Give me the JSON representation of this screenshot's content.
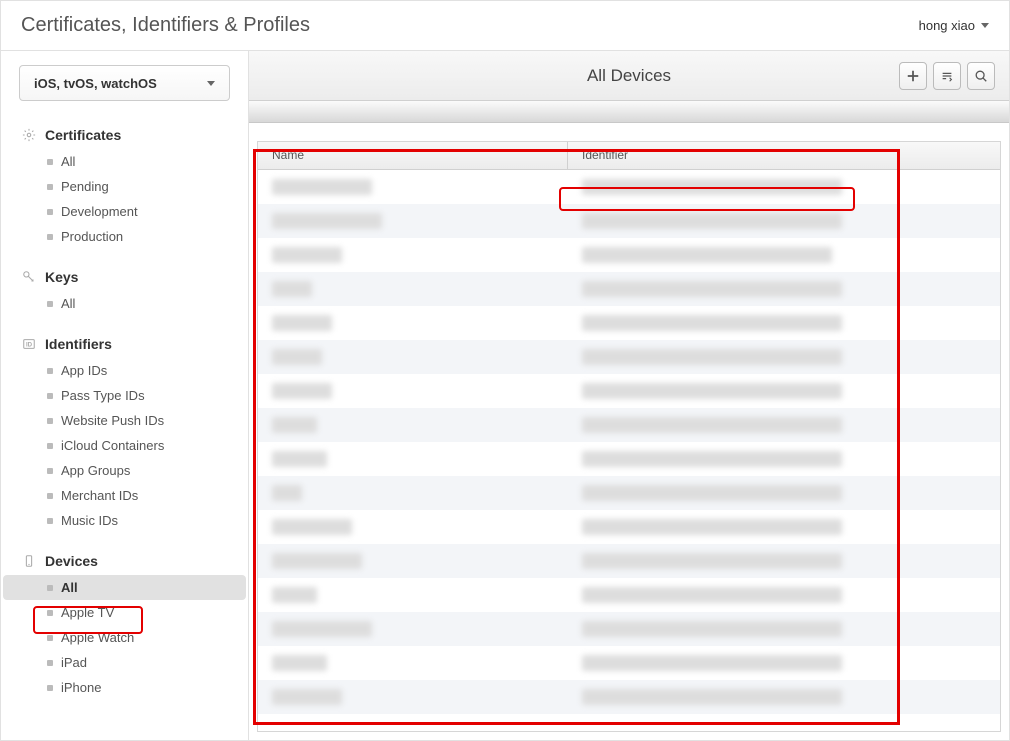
{
  "header": {
    "title": "Certificates, Identifiers & Profiles",
    "account_name": "hong xiao"
  },
  "sidebar": {
    "platform_label": "iOS, tvOS, watchOS",
    "sections": [
      {
        "title": "Certificates",
        "icon": "gear",
        "items": [
          {
            "label": "All",
            "selected": false
          },
          {
            "label": "Pending",
            "selected": false
          },
          {
            "label": "Development",
            "selected": false
          },
          {
            "label": "Production",
            "selected": false
          }
        ]
      },
      {
        "title": "Keys",
        "icon": "key",
        "items": [
          {
            "label": "All",
            "selected": false
          }
        ]
      },
      {
        "title": "Identifiers",
        "icon": "id",
        "items": [
          {
            "label": "App IDs",
            "selected": false
          },
          {
            "label": "Pass Type IDs",
            "selected": false
          },
          {
            "label": "Website Push IDs",
            "selected": false
          },
          {
            "label": "iCloud Containers",
            "selected": false
          },
          {
            "label": "App Groups",
            "selected": false
          },
          {
            "label": "Merchant IDs",
            "selected": false
          },
          {
            "label": "Music IDs",
            "selected": false
          }
        ]
      },
      {
        "title": "Devices",
        "icon": "device",
        "items": [
          {
            "label": "All",
            "selected": true
          },
          {
            "label": "Apple TV",
            "selected": false
          },
          {
            "label": "Apple Watch",
            "selected": false
          },
          {
            "label": "iPad",
            "selected": false
          },
          {
            "label": "iPhone",
            "selected": false
          }
        ]
      }
    ]
  },
  "content": {
    "title": "All Devices",
    "table": {
      "columns": [
        "Name",
        "Identifier"
      ],
      "rows": [
        {
          "name_blur_w": 100,
          "id_blur_w": 260
        },
        {
          "name_blur_w": 110,
          "id_blur_w": 260
        },
        {
          "name_blur_w": 70,
          "id_blur_w": 250
        },
        {
          "name_blur_w": 40,
          "id_blur_w": 260
        },
        {
          "name_blur_w": 60,
          "id_blur_w": 260
        },
        {
          "name_blur_w": 50,
          "id_blur_w": 260
        },
        {
          "name_blur_w": 60,
          "id_blur_w": 260
        },
        {
          "name_blur_w": 45,
          "id_blur_w": 260
        },
        {
          "name_blur_w": 55,
          "id_blur_w": 260
        },
        {
          "name_blur_w": 30,
          "id_blur_w": 260
        },
        {
          "name_blur_w": 80,
          "id_blur_w": 260
        },
        {
          "name_blur_w": 90,
          "id_blur_w": 260
        },
        {
          "name_blur_w": 45,
          "id_blur_w": 260
        },
        {
          "name_blur_w": 100,
          "id_blur_w": 260
        },
        {
          "name_blur_w": 55,
          "id_blur_w": 260
        },
        {
          "name_blur_w": 70,
          "id_blur_w": 260
        }
      ]
    }
  }
}
